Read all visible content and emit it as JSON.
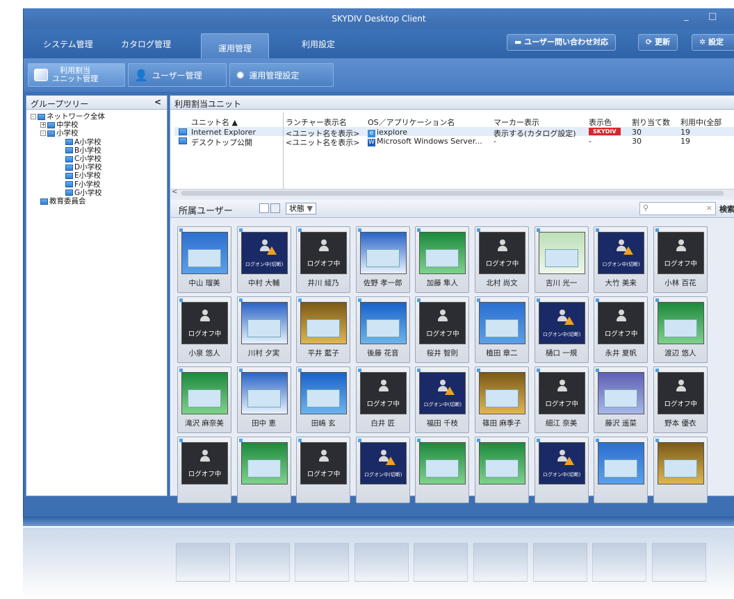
{
  "window": {
    "title": "SKYDIV Desktop Client",
    "minimize": "_",
    "maximize": "□"
  },
  "menu": {
    "tabs": [
      "システム管理",
      "カタログ管理",
      "運用管理",
      "利用設定"
    ],
    "active_index": 2
  },
  "toolbar": {
    "inquiry": "ユーザー問い合わせ対応",
    "refresh": "更新",
    "settings": "設定"
  },
  "subnav": [
    {
      "label": "利用割当\nユニット管理",
      "l1": "利用割当",
      "l2": "ユニット管理"
    },
    {
      "label": "ユーザー管理"
    },
    {
      "label": "運用管理設定"
    }
  ],
  "tree": {
    "header": "グループツリー",
    "collapse": "<",
    "nodes": [
      {
        "label": "ネットワーク全体",
        "level": 0,
        "exp": "-"
      },
      {
        "label": "中学校",
        "level": 1,
        "exp": "+"
      },
      {
        "label": "小学校",
        "level": 1,
        "exp": "-"
      },
      {
        "label": "A小学校",
        "level": 2
      },
      {
        "label": "B小学校",
        "level": 2
      },
      {
        "label": "C小学校",
        "level": 2
      },
      {
        "label": "D小学校",
        "level": 2
      },
      {
        "label": "E小学校",
        "level": 2
      },
      {
        "label": "F小学校",
        "level": 2
      },
      {
        "label": "G小学校",
        "level": 2
      },
      {
        "label": "教育委員会",
        "level": 1
      }
    ]
  },
  "units": {
    "header": "利用割当ユニット",
    "columns": [
      "ユニット名 ▲",
      "ランチャー表示名",
      "OS／アプリケーション名",
      "マーカー表示",
      "表示色",
      "割り当て数",
      "利用中(全部"
    ],
    "rows": [
      {
        "name": "Internet Explorer",
        "launcher": "<ユニット名を表示>",
        "app": "iexplore",
        "marker": "表示する(カタログ設定)",
        "color": "SKYDIV",
        "assigned": "30",
        "inuse": "19"
      },
      {
        "name": "デスクトップ公開",
        "launcher": "<ユニット名を表示>",
        "app": "Microsoft Windows Server...",
        "marker": "-",
        "color": "-",
        "assigned": "30",
        "inuse": "19"
      }
    ]
  },
  "users": {
    "header": "所属ユーザー",
    "filter": "状態",
    "search_placeholder": "",
    "clear": "×",
    "search_btn": "検索",
    "tiles": [
      [
        "中山 瑠美",
        "desktop"
      ],
      [
        "中村 大輔",
        "logon-warn"
      ],
      [
        "井川 綾乃",
        "logoff"
      ],
      [
        "佐野 孝一郎",
        "desktop-white"
      ],
      [
        "加藤 隼人",
        "desktop-green"
      ],
      [
        "北村 尚文",
        "logoff"
      ],
      [
        "吉川 光一",
        "desktop-map"
      ],
      [
        "大竹 美来",
        "logon-warn"
      ],
      [
        "小林 百花",
        "logoff"
      ],
      [
        "小泉 悠人",
        "logoff"
      ],
      [
        "川村 夕実",
        "desktop-white"
      ],
      [
        "平井 藍子",
        "desktop-gold"
      ],
      [
        "後藤 花音",
        "desktop-blue"
      ],
      [
        "桜井 智則",
        "logoff"
      ],
      [
        "植田 章二",
        "desktop"
      ],
      [
        "樋口 一規",
        "logon-warn"
      ],
      [
        "永井 夏帆",
        "logoff"
      ],
      [
        "渡辺 悠人",
        "desktop-green"
      ],
      [
        "滝沢 麻奈美",
        "desktop-green"
      ],
      [
        "田中 恵",
        "desktop-white"
      ],
      [
        "田嶋 玄",
        "desktop-blue"
      ],
      [
        "白井 匠",
        "logoff"
      ],
      [
        "福田 千枝",
        "logon-warn"
      ],
      [
        "篠田 麻季子",
        "desktop-gold"
      ],
      [
        "細江 奈美",
        "logoff"
      ],
      [
        "藤沢 遥菜",
        "desktop-purple"
      ],
      [
        "野本 優衣",
        "logoff"
      ],
      [
        "",
        "logoff"
      ],
      [
        "",
        "desktop-green"
      ],
      [
        "",
        "logoff"
      ],
      [
        "",
        "logon-warn"
      ],
      [
        "",
        "desktop-green"
      ],
      [
        "",
        "desktop-green"
      ],
      [
        "",
        "logon-warn"
      ],
      [
        "",
        "desktop"
      ],
      [
        "",
        "desktop-gold"
      ]
    ],
    "status_logoff": "ログオフ中",
    "status_logon": "ログオン中(切断)"
  },
  "colors": {
    "frame": "#3d6fb3",
    "skydiv_badge": "#d8262b"
  }
}
